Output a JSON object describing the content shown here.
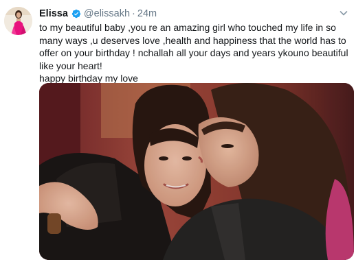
{
  "tweet": {
    "author_name": "Elissa",
    "handle": "@elissakh",
    "separator": "·",
    "time": "24m",
    "text_line_1": "to my beautiful baby  ,you re an amazing girl  who touched my life in so many ways ,u deserves love ,health and happiness that the world has to offer on your birthday ! nchallah all your days and years ykouno beautiful like your heart!",
    "text_line_2": "happy birthday my love",
    "icons": {
      "verified": "verified-badge-icon",
      "menu": "chevron-down-icon"
    },
    "colors": {
      "verified_blue": "#1da1f2",
      "secondary_text": "#657786",
      "primary_text": "#14171a"
    }
  }
}
